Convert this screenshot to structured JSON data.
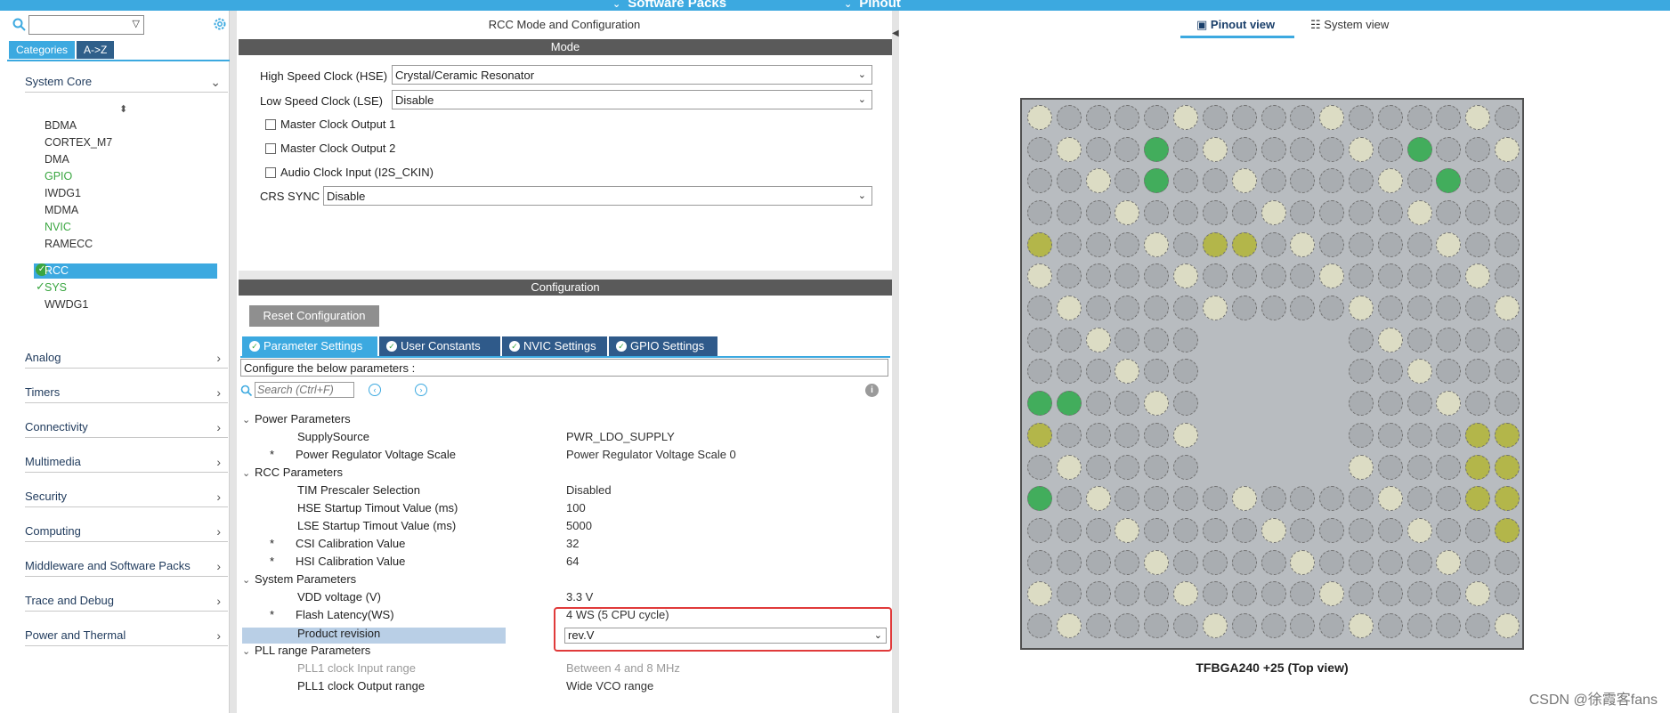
{
  "topbar": {
    "software_packs": "Software Packs",
    "pinout": "Pinout"
  },
  "left": {
    "tabs": [
      "Categories",
      "A->Z"
    ],
    "categories_top": "System Core",
    "system_core_items": [
      "BDMA",
      "CORTEX_M7",
      "DMA",
      "GPIO",
      "IWDG1",
      "MDMA",
      "NVIC",
      "RAMECC",
      "RCC",
      "SYS",
      "WWDG1"
    ],
    "categories": [
      "Analog",
      "Timers",
      "Connectivity",
      "Multimedia",
      "Security",
      "Computing",
      "Middleware and Software Packs",
      "Trace and Debug",
      "Power and Thermal"
    ]
  },
  "center": {
    "title": "RCC Mode and Configuration",
    "mode_bar": "Mode",
    "hse_label": "High Speed Clock (HSE)",
    "hse_value": "Crystal/Ceramic Resonator",
    "lse_label": "Low Speed Clock (LSE)",
    "lse_value": "Disable",
    "mco1": "Master Clock Output 1",
    "mco2": "Master Clock Output 2",
    "audio": "Audio Clock Input (I2S_CKIN)",
    "crs_label": "CRS SYNC",
    "crs_value": "Disable",
    "config_bar": "Configuration",
    "reset_button": "Reset Configuration",
    "config_tabs": [
      "Parameter Settings",
      "User Constants",
      "NVIC Settings",
      "GPIO Settings"
    ],
    "configure_hint": "Configure the below parameters :",
    "search_placeholder": "Search (Ctrl+F)",
    "groups": {
      "power": "Power Parameters",
      "rcc": "RCC Parameters",
      "system": "System Parameters",
      "pll": "PLL range Parameters"
    },
    "params": [
      {
        "name": "SupplySource",
        "value": "PWR_LDO_SUPPLY"
      },
      {
        "name": "Power Regulator Voltage Scale",
        "value": "Power Regulator Voltage Scale 0"
      },
      {
        "name": "TIM Prescaler Selection",
        "value": "Disabled"
      },
      {
        "name": "HSE Startup Timout Value (ms)",
        "value": "100"
      },
      {
        "name": "LSE Startup Timout Value (ms)",
        "value": "5000"
      },
      {
        "name": "CSI Calibration Value",
        "value": "32"
      },
      {
        "name": "HSI Calibration Value",
        "value": "64"
      },
      {
        "name": "VDD voltage (V)",
        "value": "3.3 V"
      },
      {
        "name": "Flash Latency(WS)",
        "value": "4 WS (5 CPU cycle)"
      },
      {
        "name": "Product revision",
        "value": "rev.V"
      },
      {
        "name": "PLL1 clock Input range",
        "value": "Between 4 and 8 MHz"
      },
      {
        "name": "PLL1 clock Output range",
        "value": "Wide VCO range"
      }
    ]
  },
  "right": {
    "view_tabs": [
      "Pinout view",
      "System view"
    ],
    "chip_label": "TFBGA240 +25 (Top view)",
    "watermark": "CSDN @徐霞客fans"
  }
}
